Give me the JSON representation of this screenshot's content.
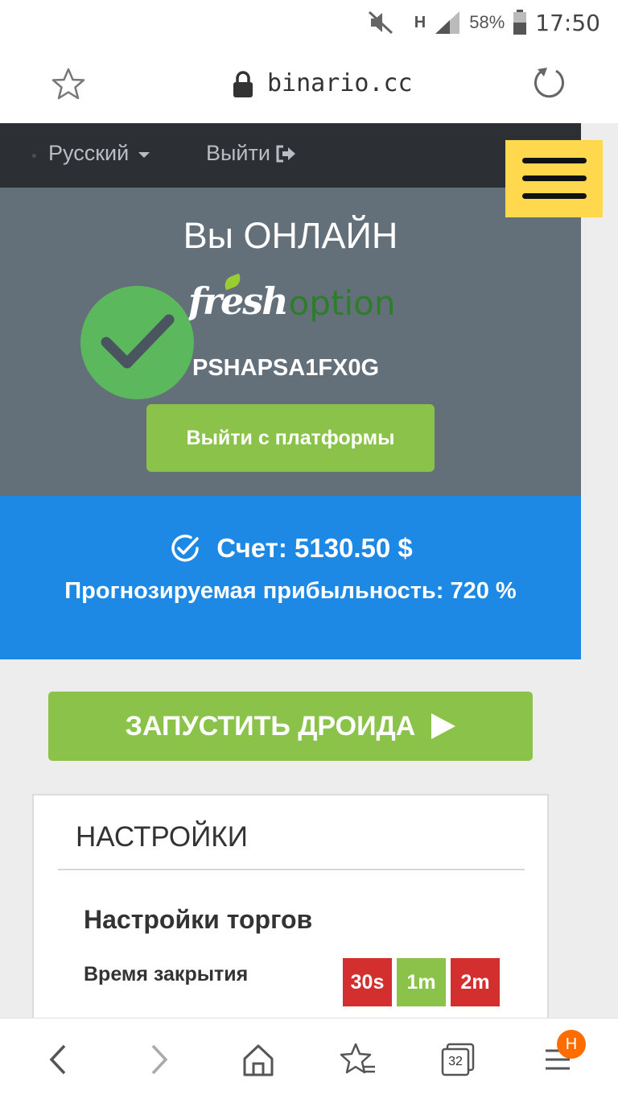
{
  "status_bar": {
    "battery": "58%",
    "time": "17:50",
    "network": "H"
  },
  "browser": {
    "url": "binario.cc",
    "tabs_count": "32",
    "menu_badge": "H"
  },
  "nav": {
    "language": "Русский",
    "logout": "Выйти"
  },
  "panel": {
    "title": "Вы ОНЛАЙН",
    "brand_fresh": "fresh",
    "brand_option": "option",
    "account_id": "PSHAPSA1FX0G",
    "exit_button": "Выйти с платформы"
  },
  "account": {
    "balance": "Счет: 5130.50 $",
    "profit": "Прогнозируемая прибыльность: 720 %"
  },
  "start_button": "ЗАПУСТИТЬ ДРОИДА",
  "settings": {
    "title": "НАСТРОЙКИ",
    "subtitle": "Настройки торгов",
    "close_time_label": "Время закрытия",
    "time_options": [
      {
        "label": "30s",
        "color": "#d32f2f"
      },
      {
        "label": "1m",
        "color": "#8bc34a"
      },
      {
        "label": "2m",
        "color": "#d32f2f"
      }
    ]
  },
  "colors": {
    "accent_green": "#8bc34a",
    "accent_blue": "#1e88e5",
    "accent_yellow": "#ffd84d",
    "panel_gray": "#647079"
  }
}
